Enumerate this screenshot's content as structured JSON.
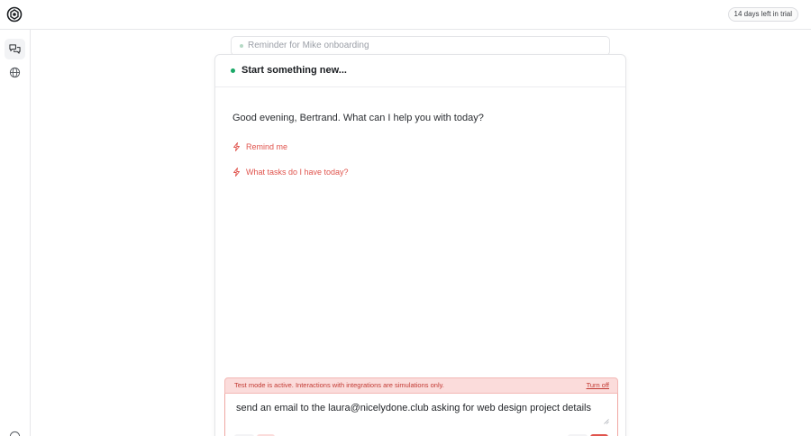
{
  "topbar": {
    "trial_badge": "14 days left in trial"
  },
  "sidebar": {
    "items": [
      {
        "icon": "chat-bubbles-icon",
        "active": true
      },
      {
        "icon": "globe-icon",
        "active": false
      },
      {
        "icon": "help-icon",
        "active": false
      }
    ]
  },
  "recent": {
    "label": "Reminder for Mike onboarding"
  },
  "chat": {
    "title": "Start something new...",
    "greeting": "Good evening, Bertrand. What can I help you with today?",
    "suggestions": [
      "Remind me",
      "What tasks do I have today?"
    ]
  },
  "test_mode": {
    "message": "Test mode is active. Interactions with integrations are simulations only.",
    "action": "Turn off"
  },
  "composer": {
    "value": "send an email to the laura@nicelydone.club asking for web design project details"
  },
  "colors": {
    "accent": "#e0544d",
    "status_green": "#1aa867",
    "banner_bg": "#fbdcdb"
  }
}
